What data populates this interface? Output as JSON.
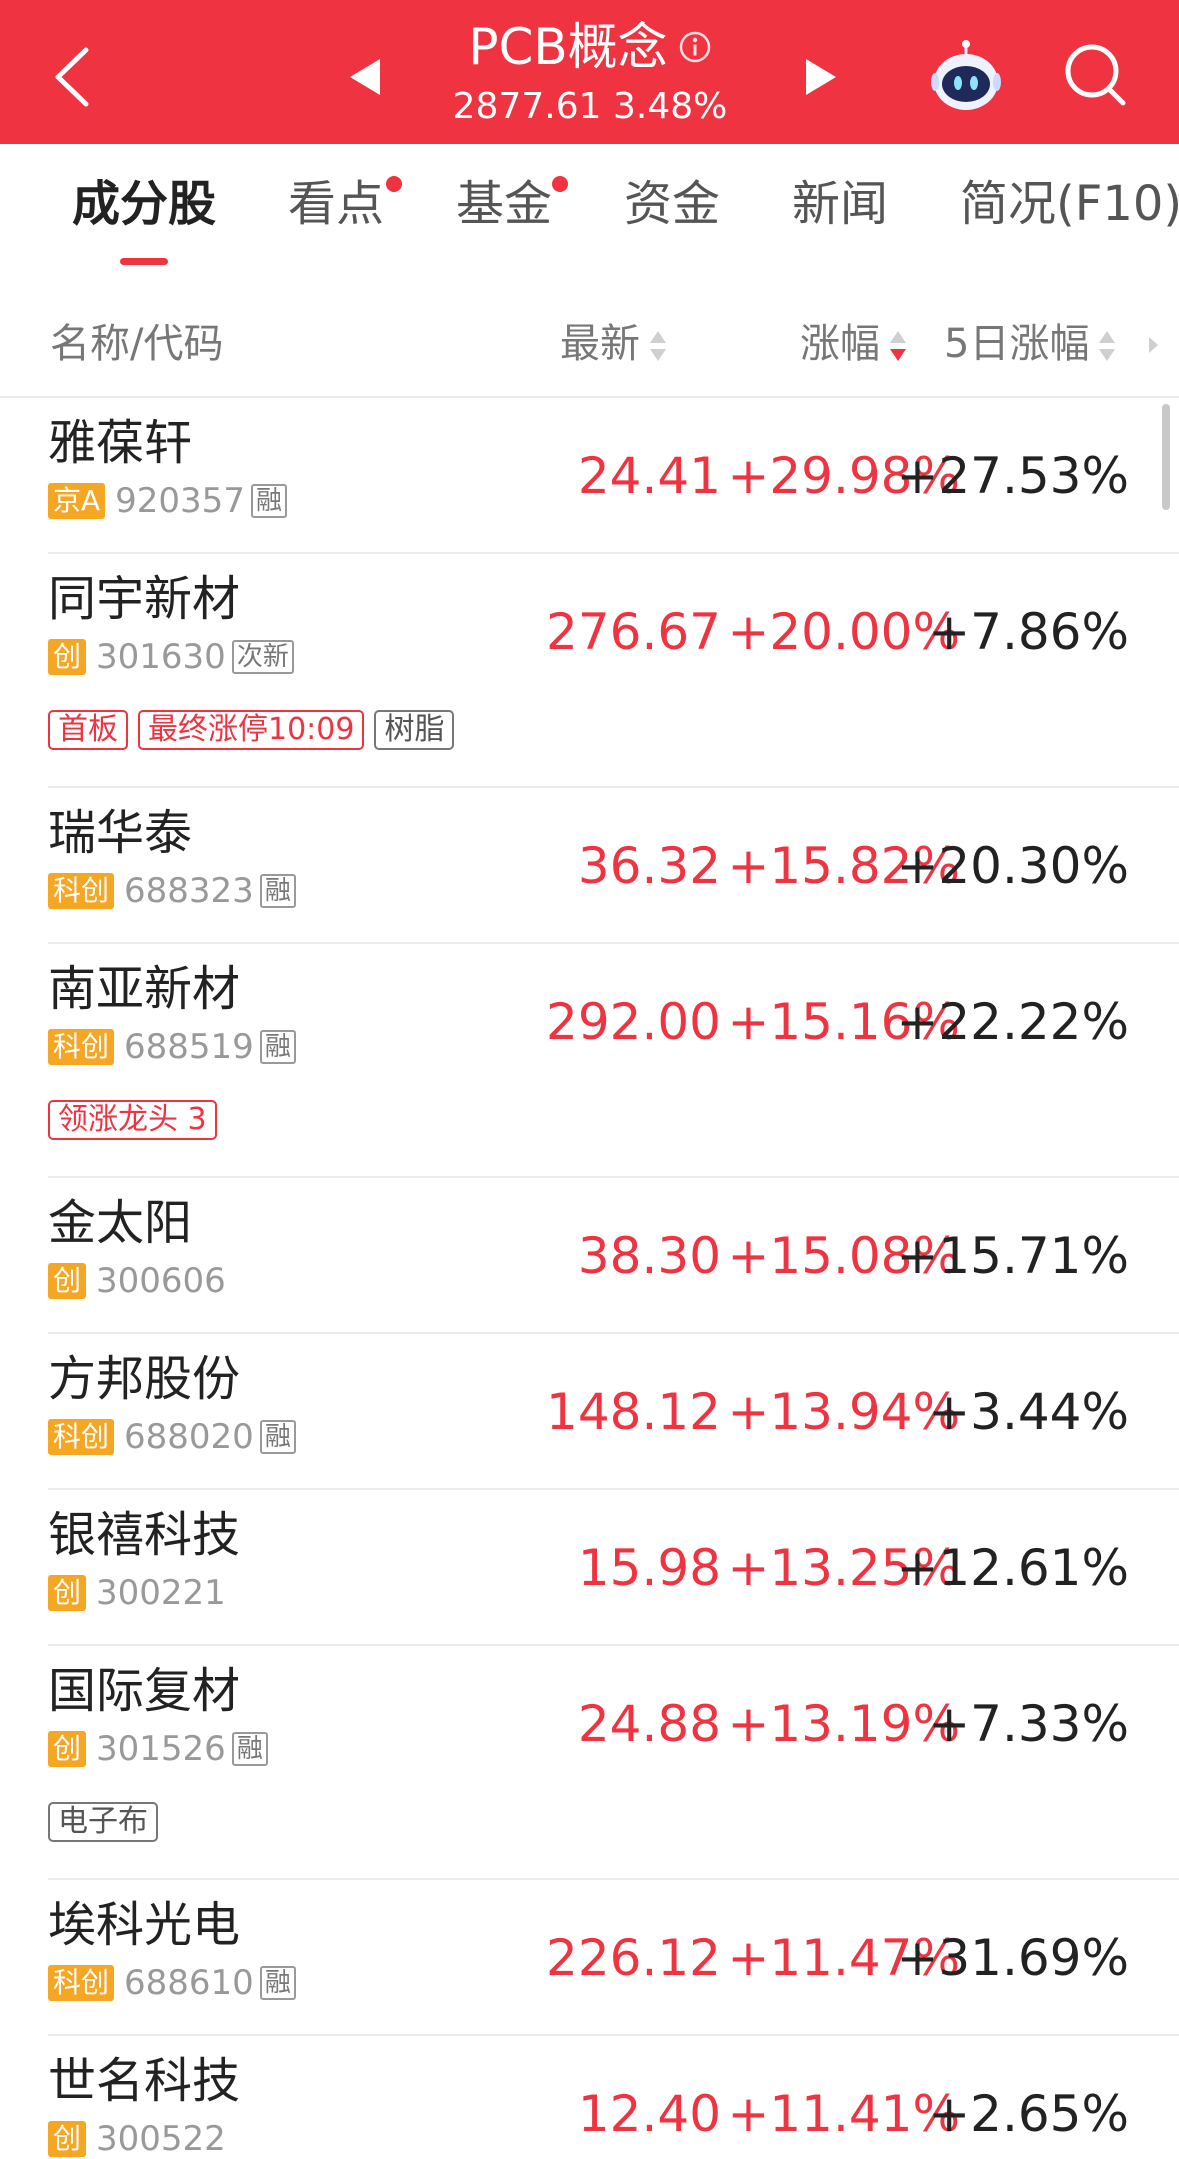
{
  "header": {
    "title": "PCB概念",
    "subtitle": "2877.61 3.48%",
    "background_color": "#ef3340",
    "icons": [
      "back-icon",
      "prev-icon",
      "info-icon",
      "next-icon",
      "robot-assistant-icon",
      "search-icon"
    ]
  },
  "tabs": [
    {
      "label": "成分股",
      "active": true,
      "dot": false
    },
    {
      "label": "看点",
      "active": false,
      "dot": true
    },
    {
      "label": "基金",
      "active": false,
      "dot": true
    },
    {
      "label": "资金",
      "active": false,
      "dot": false
    },
    {
      "label": "新闻",
      "active": false,
      "dot": false
    },
    {
      "label": "简况(F10)",
      "active": false,
      "dot": false
    }
  ],
  "columns": {
    "name_code": "名称/代码",
    "latest": "最新",
    "change": "涨幅",
    "change_5d": "5日涨幅",
    "sorted_column": "涨幅",
    "sort_direction": "descending"
  },
  "colors": {
    "up_red": "#ef3340",
    "badge_orange": "#f5a623"
  },
  "stocks": [
    {
      "name": "雅葆轩",
      "market": "京A",
      "code": "920357",
      "flag": "融",
      "price": "24.41",
      "change": "+29.98%",
      "change_5d": "+27.53%",
      "tags": []
    },
    {
      "name": "同宇新材",
      "market": "创",
      "code": "301630",
      "flag": "次新",
      "price": "276.67",
      "change": "+20.00%",
      "change_5d": "+7.86%",
      "tags": [
        {
          "text": "首板",
          "style": "red"
        },
        {
          "text": "最终涨停10:09",
          "style": "red"
        },
        {
          "text": "树脂",
          "style": "grey"
        }
      ]
    },
    {
      "name": "瑞华泰",
      "market": "科创",
      "code": "688323",
      "flag": "融",
      "price": "36.32",
      "change": "+15.82%",
      "change_5d": "+20.30%",
      "tags": []
    },
    {
      "name": "南亚新材",
      "market": "科创",
      "code": "688519",
      "flag": "融",
      "price": "292.00",
      "change": "+15.16%",
      "change_5d": "+22.22%",
      "tags": [
        {
          "text": "领涨龙头 3",
          "style": "red"
        }
      ]
    },
    {
      "name": "金太阳",
      "market": "创",
      "code": "300606",
      "flag": "",
      "price": "38.30",
      "change": "+15.08%",
      "change_5d": "+15.71%",
      "tags": []
    },
    {
      "name": "方邦股份",
      "market": "科创",
      "code": "688020",
      "flag": "融",
      "price": "148.12",
      "change": "+13.94%",
      "change_5d": "+3.44%",
      "tags": []
    },
    {
      "name": "银禧科技",
      "market": "创",
      "code": "300221",
      "flag": "",
      "price": "15.98",
      "change": "+13.25%",
      "change_5d": "+12.61%",
      "tags": []
    },
    {
      "name": "国际复材",
      "market": "创",
      "code": "301526",
      "flag": "融",
      "price": "24.88",
      "change": "+13.19%",
      "change_5d": "+7.33%",
      "tags": [
        {
          "text": "电子布",
          "style": "grey"
        }
      ]
    },
    {
      "name": "埃科光电",
      "market": "科创",
      "code": "688610",
      "flag": "融",
      "price": "226.12",
      "change": "+11.47%",
      "change_5d": "+31.69%",
      "tags": []
    },
    {
      "name": "世名科技",
      "market": "创",
      "code": "300522",
      "flag": "",
      "price": "12.40",
      "change": "+11.41%",
      "change_5d": "+2.65%",
      "tags": []
    }
  ]
}
